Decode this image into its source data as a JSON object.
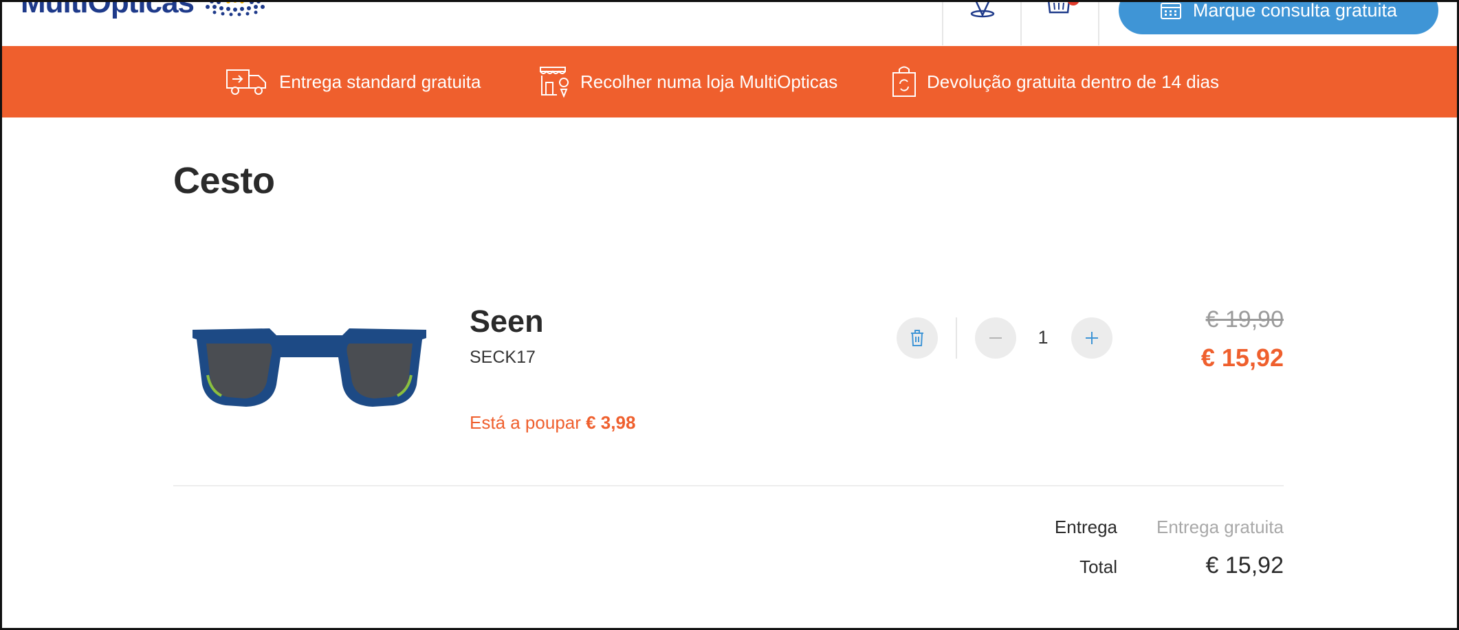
{
  "header": {
    "logo_text": "MultiOpticas",
    "consult_button": "Marque consulta gratuita",
    "icons": [
      "location-pin-icon",
      "basket-icon",
      "calendar-icon"
    ],
    "brand_color": "#1e3a8a",
    "button_color": "#3f95d6"
  },
  "banner": {
    "background": "#ef5f2d",
    "items": [
      {
        "icon": "delivery-truck-icon",
        "label": "Entrega standard gratuita"
      },
      {
        "icon": "store-pickup-icon",
        "label": "Recolher numa loja MultiOpticas"
      },
      {
        "icon": "return-bag-icon",
        "label": "Devolução gratuita dentro de 14 dias"
      }
    ]
  },
  "cart": {
    "title": "Cesto",
    "item": {
      "name": "Seen",
      "sku": "SECK17",
      "savings_label": "Está a poupar",
      "savings_amount": "€ 3,98",
      "quantity": "1",
      "old_price": "€ 19,90",
      "price": "€ 15,92"
    },
    "summary": {
      "delivery_label": "Entrega",
      "delivery_value": "Entrega gratuita",
      "total_label": "Total",
      "total_value": "€ 15,92"
    }
  },
  "accent_color": "#ef5f2d"
}
